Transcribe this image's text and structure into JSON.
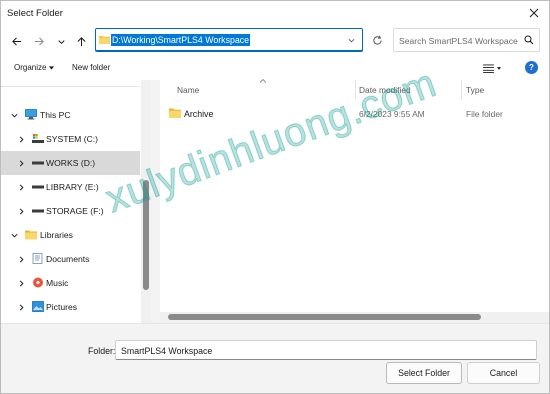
{
  "window": {
    "title": "Select Folder"
  },
  "address_bar": {
    "path": "D:\\Working\\SmartPLS4 Workspace"
  },
  "search": {
    "placeholder": "Search SmartPLS4 Workspace"
  },
  "toolbar": {
    "organize_label": "Organize",
    "new_folder_label": "New folder"
  },
  "nav_pane": {
    "items": [
      {
        "label": "This PC",
        "icon": "computer-icon",
        "expanded": true,
        "level": 0
      },
      {
        "label": "SYSTEM (C:)",
        "icon": "drive-system-icon",
        "expanded": false,
        "level": 1
      },
      {
        "label": "WORKS (D:)",
        "icon": "drive-icon",
        "expanded": false,
        "level": 1,
        "selected": true
      },
      {
        "label": "LIBRARY (E:)",
        "icon": "drive-icon",
        "expanded": false,
        "level": 1
      },
      {
        "label": "STORAGE (F:)",
        "icon": "drive-icon",
        "expanded": false,
        "level": 1
      },
      {
        "label": "Libraries",
        "icon": "folder-icon",
        "expanded": true,
        "level": 0
      },
      {
        "label": "Documents",
        "icon": "documents-icon",
        "expanded": false,
        "level": 1
      },
      {
        "label": "Music",
        "icon": "music-icon",
        "expanded": false,
        "level": 1
      },
      {
        "label": "Pictures",
        "icon": "pictures-icon",
        "expanded": false,
        "level": 1
      }
    ]
  },
  "file_list": {
    "columns": [
      "Name",
      "Date modified",
      "Type"
    ],
    "rows": [
      {
        "name": "Archive",
        "date_modified": "6/2/2023 9:55 AM",
        "type": "File folder",
        "icon": "folder-icon"
      }
    ]
  },
  "footer": {
    "folder_label": "Folder:",
    "folder_value": "SmartPLS4 Workspace",
    "select_button": "Select Folder",
    "cancel_button": "Cancel"
  },
  "watermark": {
    "text": "xulydinhluong.com"
  },
  "colors": {
    "accent": "#0067c0",
    "selection": "#0078d7",
    "folder": "#f4c542",
    "nav_selected": "#d9d9d9"
  }
}
